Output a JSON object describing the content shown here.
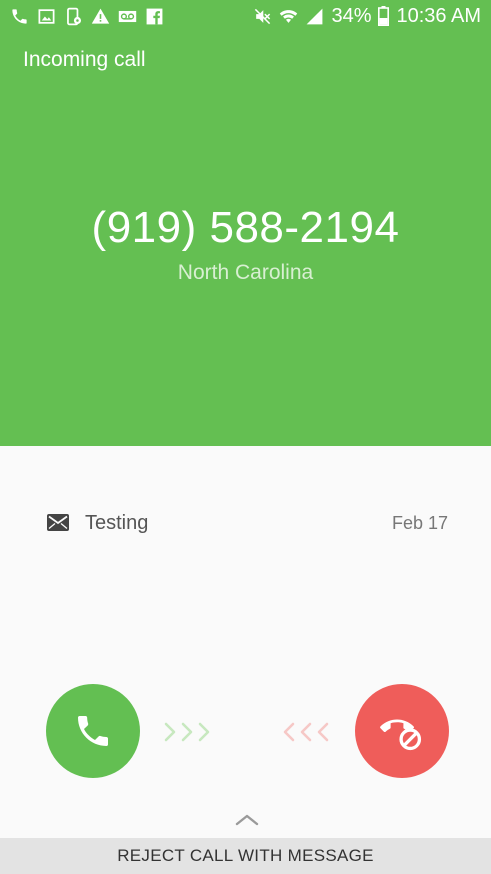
{
  "status_bar": {
    "left_icons": [
      "phone-icon",
      "image-icon",
      "phone-settings-icon",
      "warning-icon",
      "voicemail-icon",
      "facebook-icon"
    ],
    "right_icons": [
      "mute-icon",
      "wifi-icon",
      "signal-icon",
      "battery-icon"
    ],
    "battery": "34%",
    "time": "10:36 AM"
  },
  "call": {
    "header": "Incoming call",
    "number": "(919) 588-2194",
    "location": "North Carolina"
  },
  "message": {
    "icon": "envelope-icon",
    "text": "Testing",
    "date": "Feb 17"
  },
  "actions": {
    "accept_icon": "phone-icon",
    "reject_icon": "decline-phone-icon",
    "reject_message_label": "REJECT CALL WITH MESSAGE"
  },
  "colors": {
    "accent_green": "#64bf52",
    "reject_red": "#ef5d5a",
    "arrow_green": "#c7e8bf",
    "arrow_red": "#f6c8c6"
  }
}
